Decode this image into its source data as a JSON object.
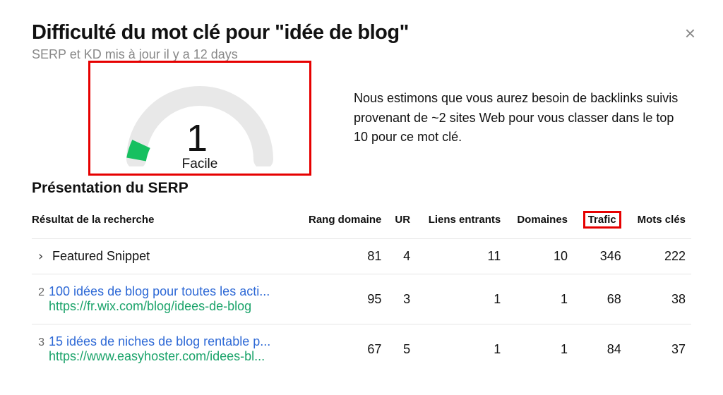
{
  "header": {
    "title": "Difficulté du mot clé pour \"idée de blog\"",
    "subtitle": "SERP et KD mis à jour il y a 12 days",
    "close": "×"
  },
  "gauge": {
    "value": "1",
    "label": "Facile"
  },
  "estimate": "Nous estimons que vous aurez besoin de backlinks suivis provenant de ~2 sites Web pour vous classer dans le top 10 pour ce mot clé.",
  "serp": {
    "heading": "Présentation du SERP",
    "columns": {
      "result": "Résultat de la recherche",
      "dr": "Rang domaine",
      "ur": "UR",
      "backlinks": "Liens entrants",
      "domains": "Domaines",
      "traffic": "Trafic",
      "keywords": "Mots clés"
    },
    "rows": [
      {
        "rank_display": "›",
        "is_chevron": true,
        "title": "Featured Snippet",
        "url": "",
        "plain": true,
        "dr": "81",
        "ur": "4",
        "backlinks": "11",
        "domains": "10",
        "traffic": "346",
        "keywords": "222"
      },
      {
        "rank_display": "2",
        "is_chevron": false,
        "title": "100 idées de blog pour toutes les acti...",
        "url": "https://fr.wix.com/blog/idees-de-blog",
        "plain": false,
        "dr": "95",
        "ur": "3",
        "backlinks": "1",
        "domains": "1",
        "traffic": "68",
        "keywords": "38"
      },
      {
        "rank_display": "3",
        "is_chevron": false,
        "title": "15 idées de niches de blog rentable p...",
        "url": "https://www.easyhoster.com/idees-bl...",
        "plain": false,
        "dr": "67",
        "ur": "5",
        "backlinks": "1",
        "domains": "1",
        "traffic": "84",
        "keywords": "37"
      }
    ]
  }
}
